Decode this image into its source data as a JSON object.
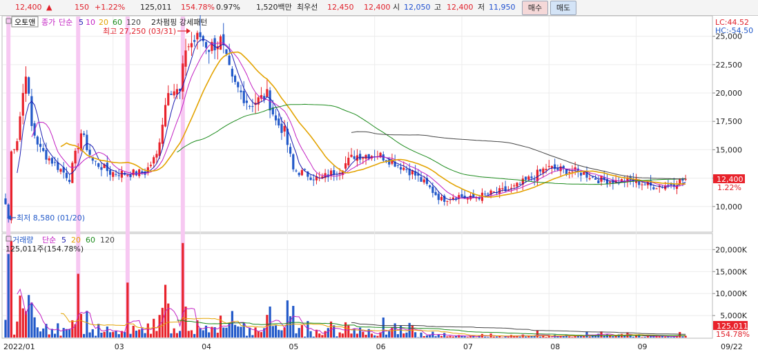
{
  "quote": {
    "price": "12,400",
    "arrow": "▲",
    "change": "150",
    "change_pct": "+1.22%",
    "volume": "125,011",
    "volume_pct": "154.78%",
    "turnover_rate": "0.97%",
    "amount": "1,520백만",
    "best_label": "최우선",
    "best_ask": "12,450",
    "best_bid": "12,400",
    "open_label": "시",
    "open": "12,050",
    "high_label": "고",
    "high": "12,400",
    "low_label": "저",
    "low": "11,950"
  },
  "buttons": {
    "buy": "매수",
    "sell": "매도"
  },
  "legend": {
    "name": "오토앤",
    "price_type": "종가",
    "ma_type": "단순",
    "ma_periods": [
      "5",
      "10",
      "20",
      "60",
      "120"
    ],
    "pattern_title": "2차펌핑 강세패턴",
    "volume_title": "거래량",
    "volume_value": "125,011주(154.78%)"
  },
  "annotations": {
    "high": "최고 27,250 (03/31)",
    "low": "최저 8,580 (01/20)"
  },
  "right_info": {
    "lc": "LC:44.52",
    "hc": "HC:-54.50"
  },
  "price_tag": {
    "value": "12,400",
    "pct": "1.22%"
  },
  "volume_tag": {
    "value": "125,011",
    "pct": "154.78%"
  },
  "colors": {
    "up": "#e8222b",
    "down": "#2259c9",
    "ma5": "#1a1ab0",
    "ma10": "#c21ec2",
    "ma20": "#e3a300",
    "ma60": "#1a8a1a",
    "ma120": "#444444",
    "highlight": "#f7c8f2"
  },
  "chart_data": {
    "type": "candlestick",
    "price_axis": {
      "ticks": [
        10000,
        12500,
        15000,
        17500,
        20000,
        22500,
        25000
      ],
      "labels": [
        "10,000",
        "12,500",
        "15,000",
        "17,500",
        "20,000",
        "22,500",
        "25,000"
      ],
      "range": [
        7800,
        26800
      ]
    },
    "volume_axis": {
      "ticks": [
        5000,
        10000,
        15000,
        20000
      ],
      "labels": [
        "5,000K",
        "10,000K",
        "15,000K",
        "20,000K"
      ],
      "range": [
        0,
        23500
      ]
    },
    "x_labels": [
      {
        "label": "2022/01",
        "index": 0
      },
      {
        "label": "03",
        "index": 37
      },
      {
        "label": "04",
        "index": 67
      },
      {
        "label": "05",
        "index": 97
      },
      {
        "label": "06",
        "index": 127
      },
      {
        "label": "07",
        "index": 157
      },
      {
        "label": "08",
        "index": 187
      },
      {
        "label": "09",
        "index": 217
      },
      {
        "label": "09/22",
        "index": 249
      }
    ],
    "highlight_indices": [
      1,
      25,
      42,
      61
    ],
    "high_index": 67,
    "low_index": 1,
    "days": 235,
    "anchors": [
      [
        0,
        10200
      ],
      [
        1,
        8580
      ],
      [
        2,
        14800
      ],
      [
        4,
        16000
      ],
      [
        7,
        22000
      ],
      [
        9,
        17000
      ],
      [
        12,
        15000
      ],
      [
        16,
        14000
      ],
      [
        22,
        12500
      ],
      [
        26,
        16500
      ],
      [
        30,
        14000
      ],
      [
        36,
        13000
      ],
      [
        42,
        12900
      ],
      [
        48,
        13000
      ],
      [
        52,
        14500
      ],
      [
        56,
        20500
      ],
      [
        60,
        20000
      ],
      [
        62,
        24000
      ],
      [
        67,
        25000
      ],
      [
        70,
        24000
      ],
      [
        74,
        24600
      ],
      [
        78,
        21000
      ],
      [
        84,
        19000
      ],
      [
        90,
        19800
      ],
      [
        93,
        17500
      ],
      [
        96,
        16600
      ],
      [
        99,
        13200
      ],
      [
        103,
        12900
      ],
      [
        108,
        12400
      ],
      [
        115,
        13300
      ],
      [
        120,
        14500
      ],
      [
        128,
        14600
      ],
      [
        133,
        14000
      ],
      [
        140,
        13000
      ],
      [
        146,
        11600
      ],
      [
        150,
        10600
      ],
      [
        155,
        11000
      ],
      [
        160,
        10700
      ],
      [
        168,
        11200
      ],
      [
        174,
        11500
      ],
      [
        182,
        12700
      ],
      [
        186,
        13400
      ],
      [
        192,
        13200
      ],
      [
        198,
        13000
      ],
      [
        204,
        12400
      ],
      [
        210,
        12200
      ],
      [
        216,
        12300
      ],
      [
        222,
        11800
      ],
      [
        228,
        11900
      ],
      [
        234,
        12400
      ]
    ]
  }
}
